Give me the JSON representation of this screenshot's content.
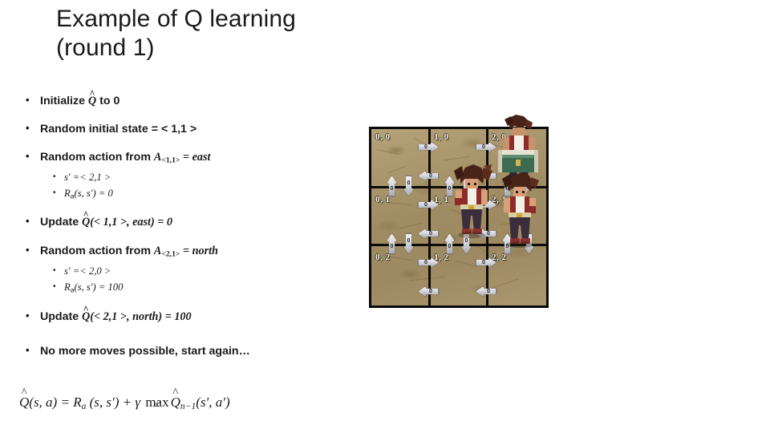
{
  "slide": {
    "title_line1": "Example of Q learning",
    "title_line2": "(round 1)"
  },
  "bullets": {
    "b1_prefix": "Initialize ",
    "b1_qhat": "Q",
    "b1_suffix": " to 0",
    "b2_text": "Random initial state = < 1,1 >",
    "b3_prefix": "Random action from ",
    "b3_A": "A",
    "b3_sub": "<1,1>",
    "b3_eq": " = ",
    "b3_action": "east",
    "b3_sub1": "s′ =< 2,1 >",
    "b3_sub2_R": "R",
    "b3_sub2_a": "a",
    "b3_sub2_rest": "(s, s′) = 0",
    "b4_prefix": "Update ",
    "b4_q": "Q",
    "b4_args": "(< 1,1 >, east) = 0",
    "b5_prefix": "Random action from ",
    "b5_A": "A",
    "b5_sub": "<2,1>",
    "b5_eq": " = ",
    "b5_action": "north",
    "b5_sub1": "s′ =< 2,0 >",
    "b5_sub2_R": "R",
    "b5_sub2_a": "a",
    "b5_sub2_rest": "(s, s′) = 100",
    "b6_prefix": "Update ",
    "b6_q": "Q",
    "b6_args": "(< 2,1 >, north) = 100",
    "b7_text": "No more moves possible, start again…"
  },
  "equation": {
    "lhs_q": "Q",
    "lhs_args": "(s, a) = ",
    "R": "R",
    "R_sub": "a",
    "R_args": " (s, s′) + ",
    "gamma": "γ",
    "max": "max",
    "max_lim": "a′",
    "q2": "Q",
    "q2_sub": "n−1",
    "q2_args": "(s′, a′)",
    "hat": "̂"
  },
  "grid": {
    "rows": 3,
    "cols": 3,
    "cell_labels": [
      {
        "id": "0-0",
        "text": "0, 0"
      },
      {
        "id": "1-0",
        "text": "1, 0"
      },
      {
        "id": "2-0",
        "text": "2, 0"
      },
      {
        "id": "0-1",
        "text": "0, 1"
      },
      {
        "id": "1-1",
        "text": "1, 1"
      },
      {
        "id": "2-1",
        "text": "2, 1"
      },
      {
        "id": "0-2",
        "text": "0, 2"
      },
      {
        "id": "1-2",
        "text": "1, 2"
      },
      {
        "id": "2-2",
        "text": "2, 2"
      }
    ],
    "q_values": {
      "a01": "0",
      "a02": "0",
      "a03": "0",
      "a04": "0",
      "a05": "0",
      "a06": "0",
      "a07": "0",
      "a08": "0",
      "a09": "0",
      "a10": "0",
      "a11": "0",
      "a12": "0",
      "a13": "0",
      "a14": "0",
      "a15": "0",
      "a16": "0",
      "a17": "0",
      "a18": "0",
      "a19": "0",
      "a20": "0",
      "a21": "0",
      "a22": "0",
      "a23": "0",
      "a24": "0"
    },
    "colors": {
      "terrain": "#a89468",
      "gridline": "#0b0b0b",
      "label": "#ffffff",
      "arrow": "#d2d4da"
    },
    "sprites": [
      {
        "name": "agent-goal-cell",
        "cell": "2, 0"
      },
      {
        "name": "agent-current-cell",
        "cell": "2, 1"
      }
    ]
  }
}
